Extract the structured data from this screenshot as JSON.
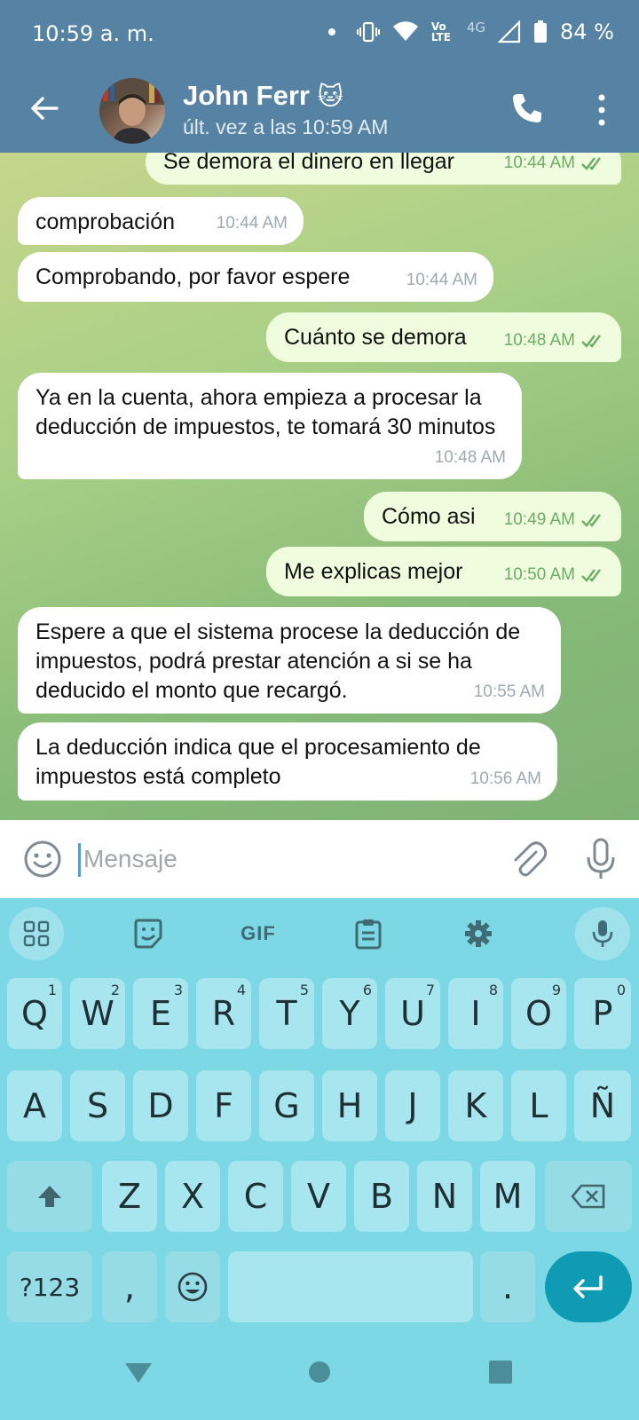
{
  "status_bar": {
    "time": "10:59 a. m.",
    "network_4g": "4G",
    "lte": "Vo LTE",
    "battery": "84 %"
  },
  "header": {
    "contact_name": "John Ferr",
    "contact_emoji": "🐱",
    "last_seen": "últ. vez a las 10:59 AM"
  },
  "messages": [
    {
      "dir": "out",
      "text": "Se demora el dinero en llegar",
      "time": "10:44 AM"
    },
    {
      "dir": "in",
      "text": "comprobación",
      "time": "10:44 AM"
    },
    {
      "dir": "in",
      "text": "Comprobando, por favor espere",
      "time": "10:44 AM"
    },
    {
      "dir": "out",
      "text": "Cuánto se demora",
      "time": "10:48 AM"
    },
    {
      "dir": "in",
      "text": "Ya en la cuenta, ahora empieza a procesar la deducción de impuestos, te tomará 30 minutos",
      "time": "10:48 AM"
    },
    {
      "dir": "out",
      "text": "Cómo asi",
      "time": "10:49 AM"
    },
    {
      "dir": "out",
      "text": "Me explicas mejor",
      "time": "10:50 AM"
    },
    {
      "dir": "in",
      "text": "Espere a que el sistema procese la deducción de impuestos, podrá prestar atención a si se ha deducido el monto que recargó.",
      "time": "10:55 AM"
    },
    {
      "dir": "in",
      "text": "La deducción indica que el procesamiento de impuestos está completo",
      "time": "10:56 AM"
    }
  ],
  "input": {
    "placeholder": "Mensaje"
  },
  "keyboard": {
    "gif_label": "GIF",
    "row1": [
      {
        "k": "Q",
        "h": "1"
      },
      {
        "k": "W",
        "h": "2"
      },
      {
        "k": "E",
        "h": "3"
      },
      {
        "k": "R",
        "h": "4"
      },
      {
        "k": "T",
        "h": "5"
      },
      {
        "k": "Y",
        "h": "6"
      },
      {
        "k": "U",
        "h": "7"
      },
      {
        "k": "I",
        "h": "8"
      },
      {
        "k": "O",
        "h": "9"
      },
      {
        "k": "P",
        "h": "0"
      }
    ],
    "row2": [
      "A",
      "S",
      "D",
      "F",
      "G",
      "H",
      "J",
      "K",
      "L",
      "Ñ"
    ],
    "row3": [
      "Z",
      "X",
      "C",
      "V",
      "B",
      "N",
      "M"
    ],
    "symbols_label": "?123",
    "comma": ",",
    "period": "."
  },
  "colors": {
    "header": "#5682a3",
    "incoming_bubble": "#ffffff",
    "outgoing_bubble": "#effdde",
    "check": "#6dac63",
    "keyboard_bg": "#7dd8e6",
    "key_bg": "#a8e6ef",
    "enter_key": "#0f9bb4"
  }
}
